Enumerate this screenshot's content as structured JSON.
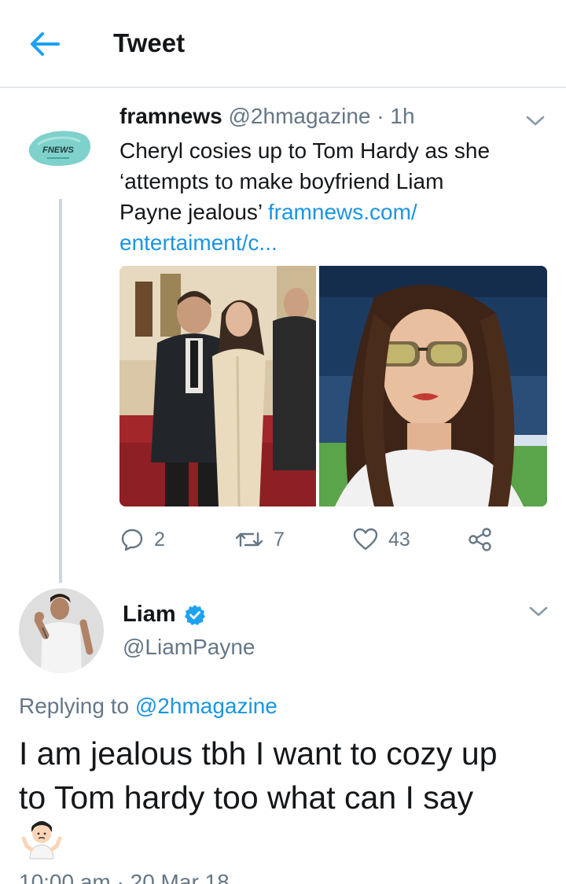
{
  "header": {
    "title": "Tweet"
  },
  "tweet": {
    "avatar_text": "FNEWS",
    "name": "framnews",
    "handle": "@2hmagazine",
    "separator": "·",
    "time": "1h",
    "text_line1": "Cheryl cosies up to Tom Hardy as she",
    "text_line2": "‘attempts to make boyfriend Liam",
    "text_line3_prefix": "Payne jealous’ ",
    "link_part1": "framnews.com/",
    "link_part2": "entertaiment/c...",
    "replies": "2",
    "retweets": "7",
    "likes": "43"
  },
  "reply": {
    "name": "Liam",
    "handle": "@LiamPayne",
    "replying_prefix": "Replying to ",
    "replying_to": "@2hmagazine",
    "text_line1": "I am jealous tbh I want to cozy up",
    "text_line2": "to Tom hardy too what can I say",
    "emoji_name": "person-shrugging-icon",
    "timestamp": "10:00 am · 20 Mar 18"
  },
  "colors": {
    "accent": "#1da1f2",
    "link": "#1b95e0",
    "secondary_text": "#657786",
    "divider": "#e1e8ed",
    "thread_line": "#ccd6dd"
  }
}
